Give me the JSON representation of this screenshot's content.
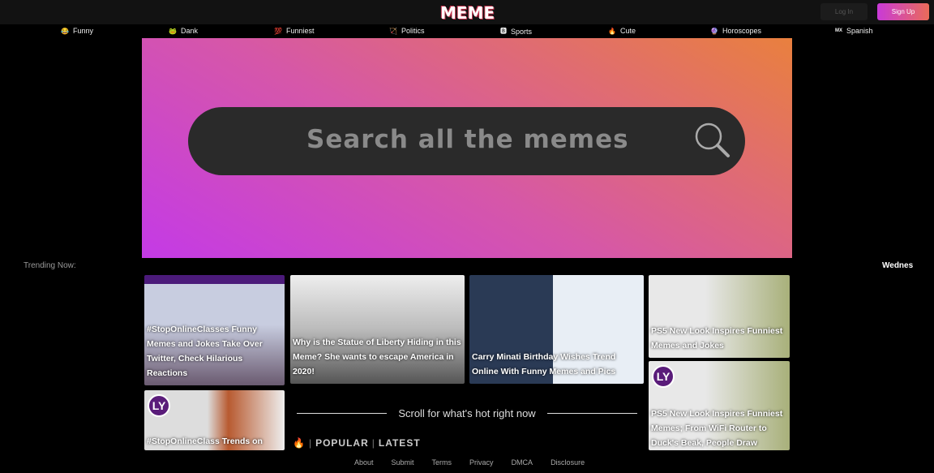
{
  "header": {
    "logo": "MEME",
    "login": "Log In",
    "signup": "Sign Up"
  },
  "nav": [
    {
      "icon": "😂",
      "label": "Funny"
    },
    {
      "icon": "🐸",
      "label": "Dank"
    },
    {
      "icon": "💯",
      "label": "Funniest"
    },
    {
      "icon": "🏹",
      "label": "Politics"
    },
    {
      "icon": "🅱",
      "label": "Sports"
    },
    {
      "icon": "🔥",
      "label": "Cute"
    },
    {
      "icon": "🔮",
      "label": "Horoscopes"
    },
    {
      "icon": "MX",
      "label": "Spanish"
    }
  ],
  "search": {
    "placeholder": "Search all the memes"
  },
  "trending": {
    "label": "Trending Now:",
    "date": "Wednes"
  },
  "cards": [
    {
      "title": "#StopOnlineClasses Funny Memes and Jokes Take Over Twitter, Check Hilarious Reactions"
    },
    {
      "title": "#StopOnlineClass Trends on",
      "badge": "LY"
    },
    {
      "title": "Why is the Statue of Liberty Hiding in this Meme? She wants to escape America in 2020!"
    },
    {
      "title": "Carry Minati Birthday Wishes Trend Online With Funny Memes and Pics"
    },
    {
      "title": "PS5 New Look Inspires Funniest Memes and Jokes"
    },
    {
      "title": "PS5 New Look Inspires Funniest Memes; From WiFi Router to Duck's Beak, People Draw",
      "badge": "LY"
    }
  ],
  "scroll_text": "Scroll for what's hot right now",
  "feed_tabs": {
    "icon": "🔥",
    "popular": "POPULAR",
    "latest": "LATEST"
  },
  "footer": [
    "About",
    "Submit",
    "Terms",
    "Privacy",
    "DMCA",
    "Disclosure"
  ]
}
